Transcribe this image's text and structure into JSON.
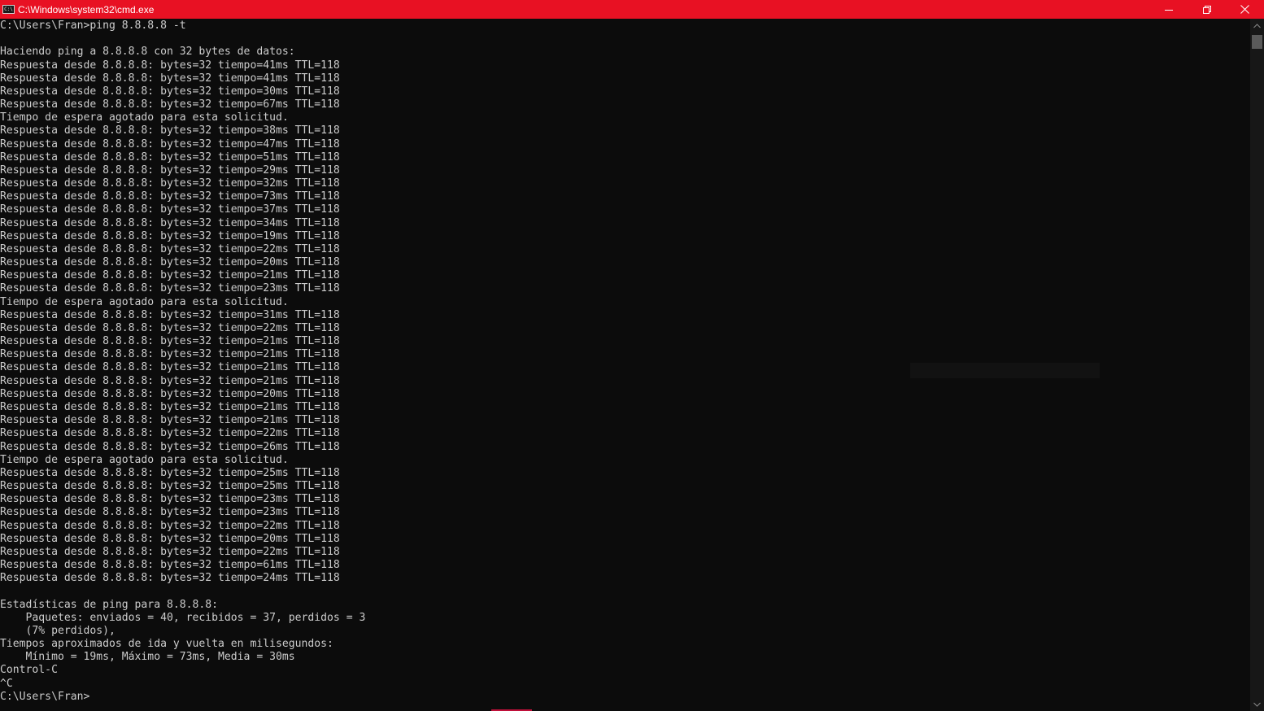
{
  "window": {
    "title": "C:\\Windows\\system32\\cmd.exe",
    "icon": "cmd-icon",
    "icon_text": "C:\\",
    "controls": [
      "minimize-icon",
      "restore-icon",
      "close-icon"
    ],
    "accent_color": "#e81123"
  },
  "console": {
    "background": "#0c0c0c",
    "text_color": "#cccccc",
    "lines": [
      "C:\\Users\\Fran>ping 8.8.8.8 -t",
      "",
      "Haciendo ping a 8.8.8.8 con 32 bytes de datos:",
      "Respuesta desde 8.8.8.8: bytes=32 tiempo=41ms TTL=118",
      "Respuesta desde 8.8.8.8: bytes=32 tiempo=41ms TTL=118",
      "Respuesta desde 8.8.8.8: bytes=32 tiempo=30ms TTL=118",
      "Respuesta desde 8.8.8.8: bytes=32 tiempo=67ms TTL=118",
      "Tiempo de espera agotado para esta solicitud.",
      "Respuesta desde 8.8.8.8: bytes=32 tiempo=38ms TTL=118",
      "Respuesta desde 8.8.8.8: bytes=32 tiempo=47ms TTL=118",
      "Respuesta desde 8.8.8.8: bytes=32 tiempo=51ms TTL=118",
      "Respuesta desde 8.8.8.8: bytes=32 tiempo=29ms TTL=118",
      "Respuesta desde 8.8.8.8: bytes=32 tiempo=32ms TTL=118",
      "Respuesta desde 8.8.8.8: bytes=32 tiempo=73ms TTL=118",
      "Respuesta desde 8.8.8.8: bytes=32 tiempo=37ms TTL=118",
      "Respuesta desde 8.8.8.8: bytes=32 tiempo=34ms TTL=118",
      "Respuesta desde 8.8.8.8: bytes=32 tiempo=19ms TTL=118",
      "Respuesta desde 8.8.8.8: bytes=32 tiempo=22ms TTL=118",
      "Respuesta desde 8.8.8.8: bytes=32 tiempo=20ms TTL=118",
      "Respuesta desde 8.8.8.8: bytes=32 tiempo=21ms TTL=118",
      "Respuesta desde 8.8.8.8: bytes=32 tiempo=23ms TTL=118",
      "Tiempo de espera agotado para esta solicitud.",
      "Respuesta desde 8.8.8.8: bytes=32 tiempo=31ms TTL=118",
      "Respuesta desde 8.8.8.8: bytes=32 tiempo=22ms TTL=118",
      "Respuesta desde 8.8.8.8: bytes=32 tiempo=21ms TTL=118",
      "Respuesta desde 8.8.8.8: bytes=32 tiempo=21ms TTL=118",
      "Respuesta desde 8.8.8.8: bytes=32 tiempo=21ms TTL=118",
      "Respuesta desde 8.8.8.8: bytes=32 tiempo=21ms TTL=118",
      "Respuesta desde 8.8.8.8: bytes=32 tiempo=20ms TTL=118",
      "Respuesta desde 8.8.8.8: bytes=32 tiempo=21ms TTL=118",
      "Respuesta desde 8.8.8.8: bytes=32 tiempo=21ms TTL=118",
      "Respuesta desde 8.8.8.8: bytes=32 tiempo=22ms TTL=118",
      "Respuesta desde 8.8.8.8: bytes=32 tiempo=26ms TTL=118",
      "Tiempo de espera agotado para esta solicitud.",
      "Respuesta desde 8.8.8.8: bytes=32 tiempo=25ms TTL=118",
      "Respuesta desde 8.8.8.8: bytes=32 tiempo=25ms TTL=118",
      "Respuesta desde 8.8.8.8: bytes=32 tiempo=23ms TTL=118",
      "Respuesta desde 8.8.8.8: bytes=32 tiempo=23ms TTL=118",
      "Respuesta desde 8.8.8.8: bytes=32 tiempo=22ms TTL=118",
      "Respuesta desde 8.8.8.8: bytes=32 tiempo=20ms TTL=118",
      "Respuesta desde 8.8.8.8: bytes=32 tiempo=22ms TTL=118",
      "Respuesta desde 8.8.8.8: bytes=32 tiempo=61ms TTL=118",
      "Respuesta desde 8.8.8.8: bytes=32 tiempo=24ms TTL=118",
      "",
      "Estadísticas de ping para 8.8.8.8:",
      "    Paquetes: enviados = 40, recibidos = 37, perdidos = 3",
      "    (7% perdidos),",
      "Tiempos aproximados de ida y vuelta en milisegundos:",
      "    Mínimo = 19ms, Máximo = 73ms, Media = 30ms",
      "Control-C",
      "^C",
      "C:\\Users\\Fran>"
    ]
  },
  "scrollbar": {
    "icons": [
      "chevron-up-icon",
      "chevron-down-icon"
    ],
    "position_fraction": 0.0
  }
}
